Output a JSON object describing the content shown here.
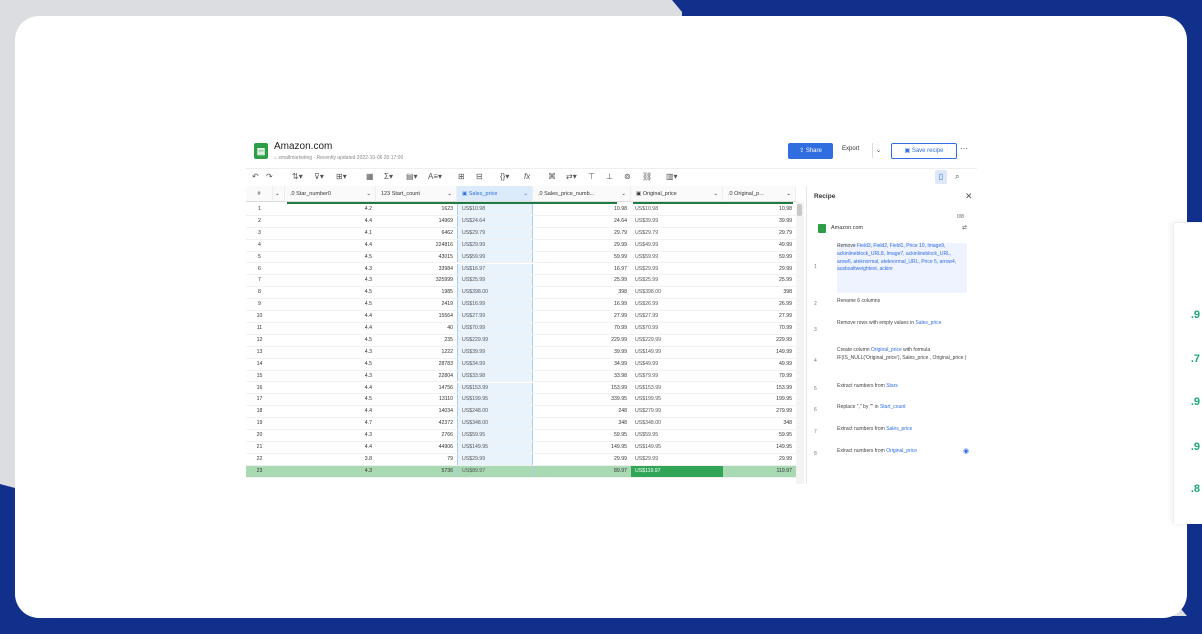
{
  "fragment_values": [
    ".9",
    ".7",
    ".9",
    ".9",
    ".8"
  ],
  "app": {
    "title": "Amazon.com",
    "owner": "smallmarketing",
    "updated": "Recently updated 2022-10-06 20:17:00",
    "share_label": "Share",
    "export_label": "Export",
    "save_label": "Save recipe"
  },
  "columns": {
    "row_num": "#",
    "stars": "Star_number0",
    "count": "Start_count",
    "sales": "Sales_price",
    "sales_num": "Sales_price_numb...",
    "orig": "Original_price",
    "orig_num": "Original_p..."
  },
  "rows": [
    {
      "n": "1",
      "stars": "4.2",
      "count": "1623",
      "sales": "US$10.98",
      "sales_num": "10.98",
      "orig": "US$10.98",
      "orig_num": "10.98"
    },
    {
      "n": "2",
      "stars": "4.4",
      "count": "14969",
      "sales": "US$24.64",
      "sales_num": "24.64",
      "orig": "US$39.99",
      "orig_num": "39.99"
    },
    {
      "n": "3",
      "stars": "4.1",
      "count": "6462",
      "sales": "US$29.79",
      "sales_num": "29.79",
      "orig": "US$29.79",
      "orig_num": "29.79"
    },
    {
      "n": "4",
      "stars": "4.4",
      "count": "224816",
      "sales": "US$29.99",
      "sales_num": "29.99",
      "orig": "US$49.99",
      "orig_num": "49.99"
    },
    {
      "n": "5",
      "stars": "4.5",
      "count": "43015",
      "sales": "US$59.99",
      "sales_num": "59.99",
      "orig": "US$59.99",
      "orig_num": "59.99"
    },
    {
      "n": "6",
      "stars": "4.3",
      "count": "33984",
      "sales": "US$16.97",
      "sales_num": "16.97",
      "orig": "US$29.99",
      "orig_num": "29.99"
    },
    {
      "n": "7",
      "stars": "4.3",
      "count": "325999",
      "sales": "US$25.99",
      "sales_num": "25.99",
      "orig": "US$25.99",
      "orig_num": "25.99"
    },
    {
      "n": "8",
      "stars": "4.5",
      "count": "1985",
      "sales": "US$398.00",
      "sales_num": "398",
      "orig": "US$398.00",
      "orig_num": "398"
    },
    {
      "n": "9",
      "stars": "4.5",
      "count": "2419",
      "sales": "US$16.99",
      "sales_num": "16.99",
      "orig": "US$26.99",
      "orig_num": "26.99"
    },
    {
      "n": "10",
      "stars": "4.4",
      "count": "15564",
      "sales": "US$27.99",
      "sales_num": "27.99",
      "orig": "US$27.99",
      "orig_num": "27.99"
    },
    {
      "n": "11",
      "stars": "4.4",
      "count": "40",
      "sales": "US$70.99",
      "sales_num": "70.99",
      "orig": "US$70.99",
      "orig_num": "70.99"
    },
    {
      "n": "12",
      "stars": "4.5",
      "count": "235",
      "sales": "US$229.99",
      "sales_num": "229.99",
      "orig": "US$229.99",
      "orig_num": "229.99"
    },
    {
      "n": "13",
      "stars": "4.3",
      "count": "1222",
      "sales": "US$39.99",
      "sales_num": "39.99",
      "orig": "US$149.99",
      "orig_num": "149.99"
    },
    {
      "n": "14",
      "stars": "4.5",
      "count": "28783",
      "sales": "US$34.99",
      "sales_num": "34.99",
      "orig": "US$49.99",
      "orig_num": "49.99"
    },
    {
      "n": "15",
      "stars": "4.3",
      "count": "22804",
      "sales": "US$33.98",
      "sales_num": "33.98",
      "orig": "US$79.99",
      "orig_num": "79.99"
    },
    {
      "n": "16",
      "stars": "4.4",
      "count": "14756",
      "sales": "US$153.99",
      "sales_num": "153.99",
      "orig": "US$153.99",
      "orig_num": "153.99"
    },
    {
      "n": "17",
      "stars": "4.5",
      "count": "13110",
      "sales": "US$199.95",
      "sales_num": "339.95",
      "orig": "US$199.95",
      "orig_num": "199.95"
    },
    {
      "n": "18",
      "stars": "4.4",
      "count": "14034",
      "sales": "US$248.00",
      "sales_num": "248",
      "orig": "US$279.99",
      "orig_num": "279.99"
    },
    {
      "n": "19",
      "stars": "4.7",
      "count": "42372",
      "sales": "US$348.00",
      "sales_num": "348",
      "orig": "US$348.00",
      "orig_num": "348"
    },
    {
      "n": "20",
      "stars": "4.3",
      "count": "2766",
      "sales": "US$59.95",
      "sales_num": "59.95",
      "orig": "US$59.95",
      "orig_num": "59.95"
    },
    {
      "n": "21",
      "stars": "4.4",
      "count": "44906",
      "sales": "US$149.95",
      "sales_num": "149.95",
      "orig": "US$149.95",
      "orig_num": "149.95"
    },
    {
      "n": "22",
      "stars": "3.8",
      "count": "79",
      "sales": "US$29.99",
      "sales_num": "29.99",
      "orig": "US$29.99",
      "orig_num": "29.99"
    },
    {
      "n": "23",
      "stars": "4.3",
      "count": "5736",
      "sales": "US$89.97",
      "sales_num": "89.97",
      "orig": "US$119.97",
      "orig_num": "119.97"
    }
  ],
  "recipe": {
    "title": "Recipe",
    "count": "0/8",
    "source": "Amazon.com",
    "steps": [
      {
        "num": "1",
        "pre": "Remove ",
        "hl": "Field3, Field2, Field1, Price 10, Image9, ackinlineblock_URL8, Image7, ackinlineblock_URL, arow6, ateknormal, ateknormal_URL, Price 5, arrow4, ausbsaltweightext, ackinr",
        "post": ""
      },
      {
        "num": "2",
        "pre": "Rename 6 columns",
        "hl": "",
        "post": ""
      },
      {
        "num": "3",
        "pre": "Remove rows with empty values in ",
        "hl": "Sales_price",
        "post": ""
      },
      {
        "num": "4",
        "pre": "Create column ",
        "hl": "Original_price",
        "post": " with formula IF(IS_NULL('Original_price'), Sales_price , Original_price )"
      },
      {
        "num": "5",
        "pre": "Extract numbers from ",
        "hl": "Stars",
        "post": ""
      },
      {
        "num": "6",
        "pre": "Replace \",\" by \"\" in ",
        "hl": "Start_count",
        "post": ""
      },
      {
        "num": "7",
        "pre": "Extract numbers from ",
        "hl": "Sales_price",
        "post": ""
      },
      {
        "num": "8",
        "pre": "Extract numbers from ",
        "hl": "Original_price",
        "post": ""
      }
    ]
  },
  "colors": {
    "accent": "#2f6de1",
    "green": "#31a556",
    "brand_bg": "#11308c"
  }
}
